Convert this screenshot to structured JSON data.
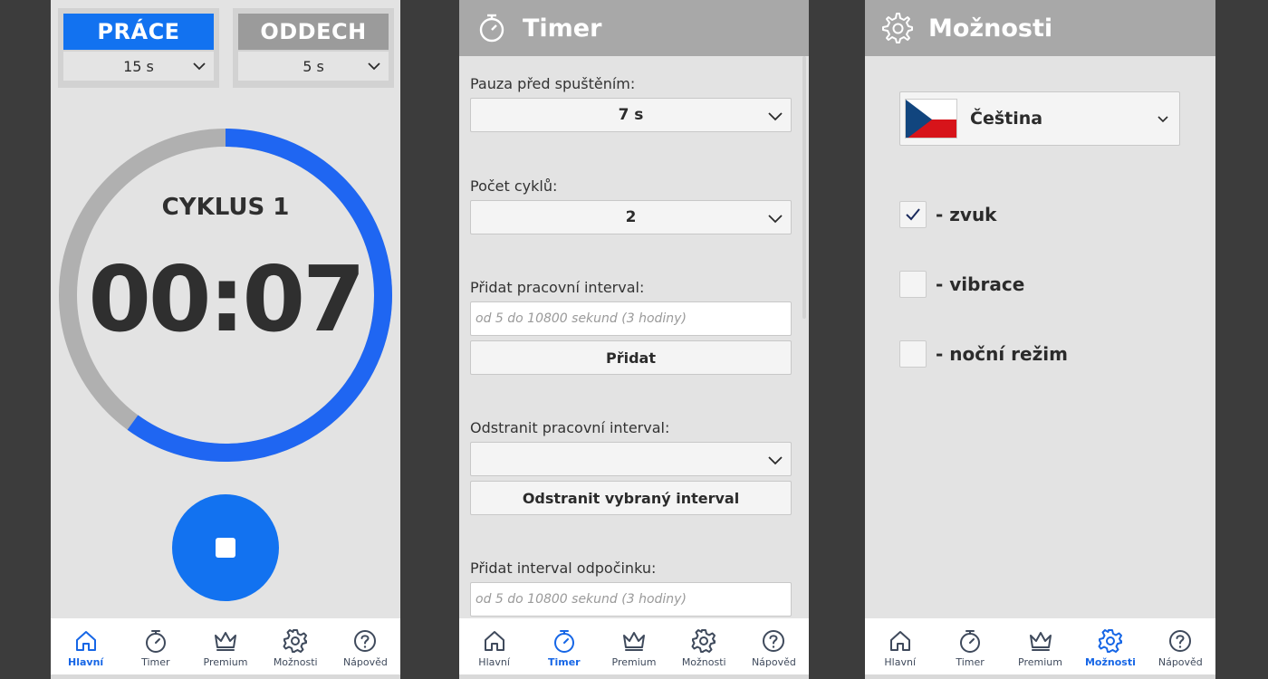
{
  "nav": {
    "items": [
      {
        "label": "Hlavní",
        "icon": "home-icon"
      },
      {
        "label": "Timer",
        "icon": "stopwatch-icon"
      },
      {
        "label": "Premium",
        "icon": "crown-icon"
      },
      {
        "label": "Možnosti",
        "icon": "gear-icon"
      },
      {
        "label": "Nápověd",
        "icon": "help-icon"
      }
    ],
    "active_color": "#1666e6"
  },
  "main": {
    "work": {
      "title": "PRÁCE",
      "value": "15 s"
    },
    "rest": {
      "title": "ODDECH",
      "value": "5 s"
    },
    "cycle_label": "CYKLUS 1",
    "time": "00:07",
    "progress_fraction": 0.6,
    "accent_color": "#1272f0"
  },
  "timer": {
    "title": "Timer",
    "pause_label": "Pauza před spuštěním:",
    "pause_value": "7 s",
    "cycles_label": "Počet cyklů:",
    "cycles_value": "2",
    "add_work_label": "Přidat pracovní interval:",
    "add_work_placeholder": "od 5 do 10800 sekund (3 hodiny)",
    "add_button": "Přidat",
    "remove_work_label": "Odstranit pracovní interval:",
    "remove_work_value": "",
    "remove_button": "Odstranit vybraný interval",
    "add_rest_label": "Přidat interval odpočinku:",
    "add_rest_placeholder": "od 5 do 10800 sekund (3 hodiny)"
  },
  "options": {
    "title": "Možnosti",
    "language": "Čeština",
    "items": [
      {
        "label": "- zvuk",
        "checked": true
      },
      {
        "label": "- vibrace",
        "checked": false
      },
      {
        "label": "- noční režim",
        "checked": false
      }
    ]
  }
}
